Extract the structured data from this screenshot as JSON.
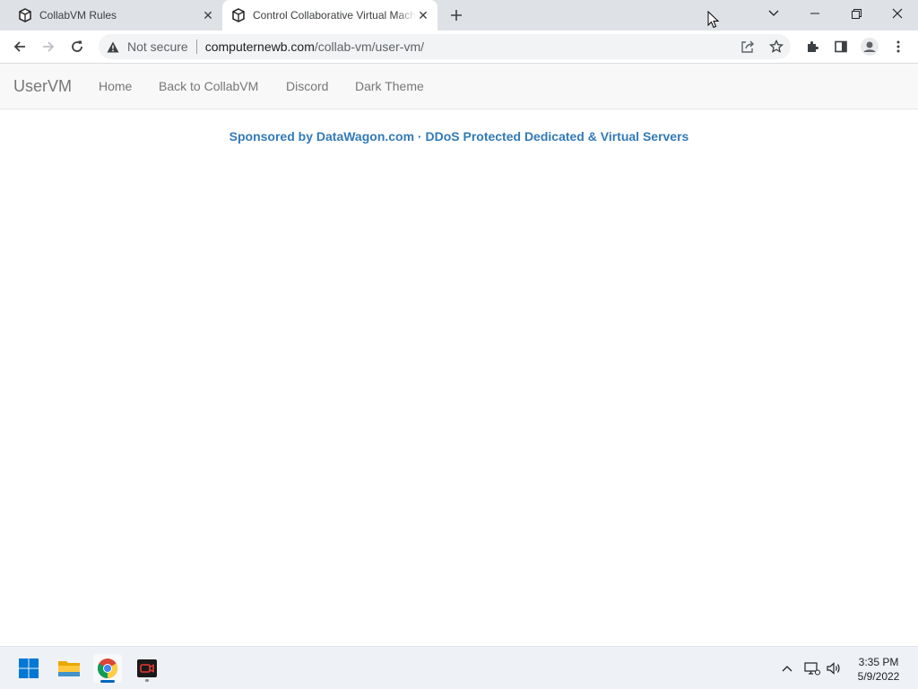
{
  "browser": {
    "tabs": [
      {
        "title": "CollabVM Rules",
        "active": false
      },
      {
        "title": "Control Collaborative Virtual Machines",
        "active": true
      }
    ],
    "address": {
      "security_label": "Not secure",
      "host": "computernewb.com",
      "path": "/collab-vm/user-vm/"
    }
  },
  "navbar": {
    "brand": "UserVM",
    "links": [
      "Home",
      "Back to CollabVM",
      "Discord",
      "Dark Theme"
    ]
  },
  "content": {
    "sponsor_text": "Sponsored by DataWagon.com · DDoS Protected Dedicated & Virtual Servers"
  },
  "taskbar": {
    "apps": [
      "start-icon",
      "file-explorer-icon",
      "chrome-icon",
      "recorder-icon"
    ],
    "time": "3:35 PM",
    "date": "5/9/2022"
  },
  "colors": {
    "link": "#337ab7",
    "navbar_bg": "#f8f8f8",
    "tabstrip_bg": "#dee1e6"
  }
}
